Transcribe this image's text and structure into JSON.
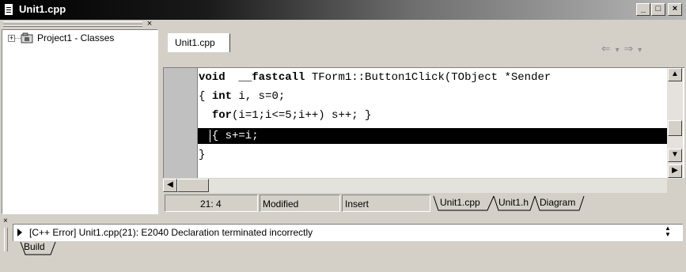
{
  "window": {
    "title": "Unit1.cpp",
    "buttons": {
      "minimize": "_",
      "maximize": "□",
      "close": "×"
    }
  },
  "class_explorer": {
    "close_glyph": "×",
    "items": [
      {
        "expander": "+",
        "label": "Project1 - Classes",
        "icon": "classes-icon"
      }
    ]
  },
  "editor": {
    "tab_label": "Unit1.cpp",
    "nav": {
      "back": "⇐",
      "dropdown": "▾",
      "forward": "⇒"
    },
    "lines": [
      {
        "kw1": "void",
        "kw2": "__fastcall",
        "rest": " TForm1::Button1Click(TObject *Sender"
      },
      {
        "pre": "{ ",
        "kw": "int",
        "rest": " i, s=0;"
      },
      {
        "pre": "  ",
        "kw": "for",
        "rest": "(i=1;i<=5;i++) s++; }"
      },
      {
        "text": "  { s+=i;"
      },
      {
        "text": "}"
      }
    ]
  },
  "status": {
    "position": "21:  4",
    "modified": "Modified",
    "mode": "Insert",
    "file_tabs": [
      "Unit1.cpp",
      "Unit1.h",
      "Diagram"
    ]
  },
  "messages": {
    "error": "[C++ Error] Unit1.cpp(21): E2040 Declaration terminated incorrectly",
    "tab": "Build"
  }
}
